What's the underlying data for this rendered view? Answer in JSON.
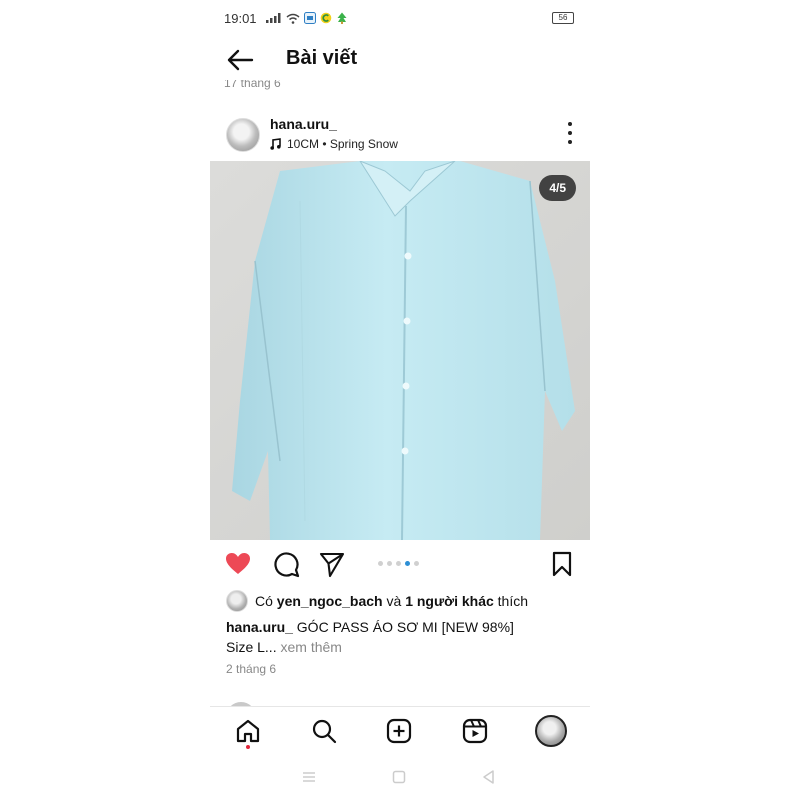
{
  "status_bar": {
    "time": "19:01",
    "battery": "56",
    "icons": [
      "signal-icon",
      "wifi-icon",
      "app-notification-icon",
      "app-c-icon",
      "app-tree-icon"
    ]
  },
  "header": {
    "title": "Bài viết",
    "prev_post_date": "17 tháng 6"
  },
  "post": {
    "username": "hana.uru_",
    "music": "10CM • Spring Snow",
    "image_counter": "4/5",
    "carousel": {
      "count": 5,
      "active_index": 3
    },
    "liked": true,
    "likes": {
      "prefix": "Có",
      "first_user": "yen_ngoc_bach",
      "connector": "và",
      "others": "1 người khác",
      "suffix": "thích"
    },
    "caption": {
      "user": "hana.uru_",
      "text": "GÓC PASS ÁO SƠ MI [NEW 98%]",
      "line2": "Size L...",
      "more_label": "xem thêm"
    },
    "date": "2 tháng 6"
  },
  "bottom_nav": {
    "items": [
      "home-icon",
      "search-icon",
      "create-icon",
      "reels-icon",
      "profile-avatar"
    ]
  },
  "colors": {
    "like_red": "#ed4956",
    "active_dot": "#2d8fd5",
    "shirt": "#bfe6ef"
  }
}
